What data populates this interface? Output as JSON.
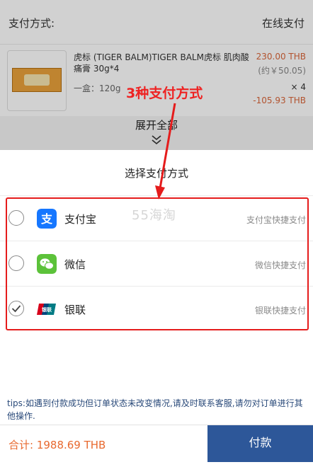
{
  "background": {
    "payment_method_label": "支付方式:",
    "payment_method_value": "在线支付",
    "product": {
      "name": "虎标 (TIGER BALM)TIGER BALM虎标 肌肉酸痛膏 30g*4",
      "spec": "一盒：120g",
      "price": "230.00 THB",
      "price_cny": "(约￥50.05)",
      "quantity": "× 4",
      "discount": "-105.93 THB"
    },
    "expand_label": "展开全部"
  },
  "annotation": {
    "text": "3种支付方式"
  },
  "watermark": "55海淘",
  "sheet": {
    "title": "选择支付方式",
    "options": [
      {
        "name": "支付宝",
        "desc": "支付宝快捷支付",
        "selected": false,
        "icon": "alipay-icon",
        "color": "#1677ff"
      },
      {
        "name": "微信",
        "desc": "微信快捷支付",
        "selected": false,
        "icon": "wechat-icon",
        "color": "#5cc23a"
      },
      {
        "name": "银联",
        "desc": "银联快捷支付",
        "selected": true,
        "icon": "unionpay-icon",
        "color": "#d7001b"
      }
    ],
    "tips": "tips:如遇到付款成功但订单状态未改变情况,请及时联系客服,请勿对订单进行其他操作.",
    "total": "合计: 1988.69 THB",
    "pay_button": "付款"
  },
  "colors": {
    "accent": "#2d5799",
    "price": "#d9663a",
    "annotation": "#e51c1c"
  }
}
